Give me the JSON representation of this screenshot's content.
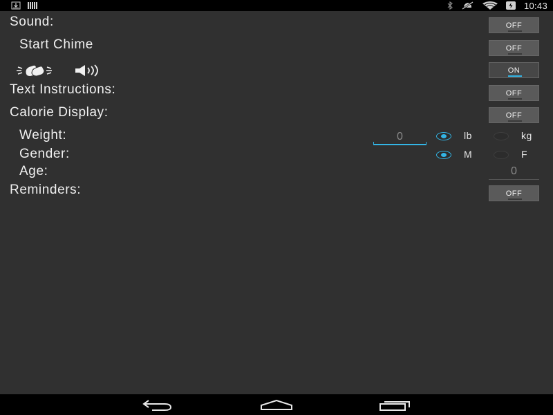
{
  "status_bar": {
    "time": "10:43",
    "left_icons": [
      "download-icon",
      "barcode-icon"
    ],
    "right_icons": [
      "bluetooth-icon",
      "mute-icon",
      "wifi-icon",
      "battery-icon"
    ]
  },
  "settings": {
    "sound": {
      "label": "Sound:",
      "toggle": "OFF"
    },
    "start_chime": {
      "label": "Start Chime",
      "toggle": "OFF"
    },
    "clap_sound": {
      "icons": [
        "clapping-hands-icon",
        "speaker-icon"
      ],
      "toggle": "ON"
    },
    "text_instructions": {
      "label": "Text Instructions:",
      "toggle": "OFF"
    },
    "calorie_display": {
      "label": "Calorie Display:",
      "toggle": "OFF"
    },
    "weight": {
      "label": "Weight:",
      "value": "0",
      "units": [
        {
          "label": "lb",
          "checked": true
        },
        {
          "label": "kg",
          "checked": false
        }
      ]
    },
    "gender": {
      "label": "Gender:",
      "options": [
        {
          "label": "M",
          "checked": true
        },
        {
          "label": "F",
          "checked": false
        }
      ]
    },
    "age": {
      "label": "Age:",
      "value": "0"
    },
    "reminders": {
      "label": "Reminders:",
      "toggle": "OFF"
    }
  },
  "nav_bar": {
    "buttons": [
      "back-icon",
      "home-icon",
      "recent-apps-icon"
    ]
  },
  "colors": {
    "background": "#303030",
    "accent": "#33b5e5",
    "toggle_bg": "#5a5a5a",
    "bars": "#000000"
  }
}
